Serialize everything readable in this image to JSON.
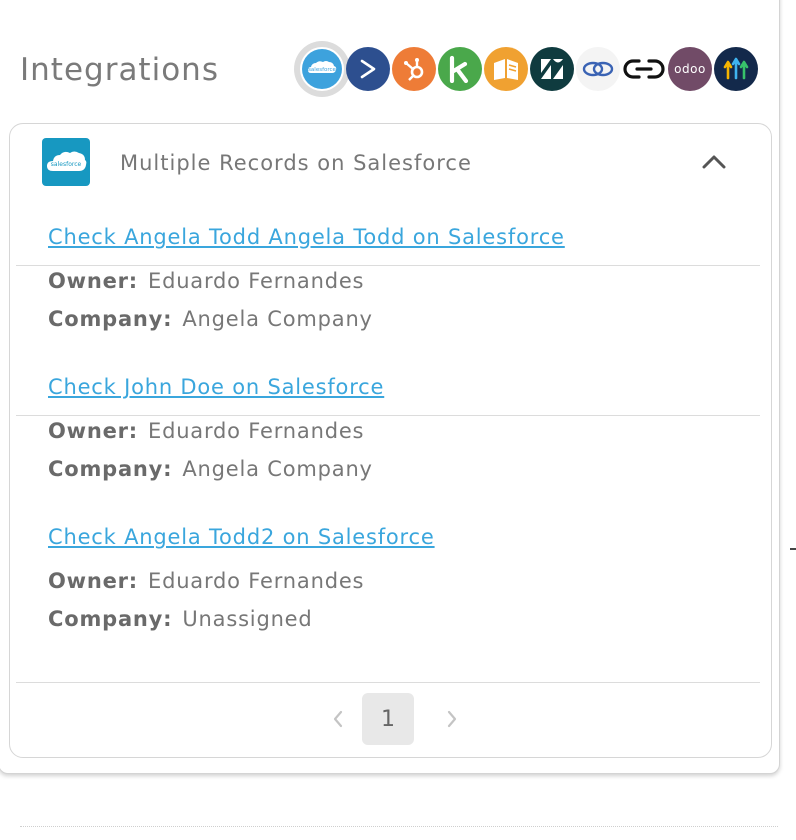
{
  "header": {
    "title": "Integrations",
    "icons": [
      {
        "name": "salesforce",
        "text": "salesforce",
        "bg": "#3da2dd",
        "selected": true
      },
      {
        "name": "pipedrive",
        "bg": "#2d4f8f"
      },
      {
        "name": "hubspot",
        "bg": "#ee7c37"
      },
      {
        "name": "keap",
        "bg": "#4aa84b"
      },
      {
        "name": "bookmark",
        "bg": "#f0a131"
      },
      {
        "name": "zendesk",
        "bg": "#0f3b3f"
      },
      {
        "name": "zoho",
        "bg": "#f4f4f4"
      },
      {
        "name": "link",
        "bg": "#ffffff"
      },
      {
        "name": "odoo",
        "text": "odoo",
        "bg": "#714b67"
      },
      {
        "name": "gohighlevel",
        "bg": "#13294b"
      }
    ]
  },
  "card": {
    "title": "Multiple Records on Salesforce",
    "logo_text": "salesforce",
    "records": [
      {
        "link": "Check Angela Todd Angela Todd on Salesforce",
        "owner_label": "Owner:",
        "owner": "Eduardo Fernandes",
        "company_label": "Company:",
        "company": "Angela Company"
      },
      {
        "link": "Check John Doe on Salesforce",
        "owner_label": "Owner:",
        "owner": "Eduardo Fernandes",
        "company_label": "Company:",
        "company": "Angela Company"
      },
      {
        "link": "Check Angela Todd2 on Salesforce",
        "owner_label": "Owner:",
        "owner": "Eduardo Fernandes",
        "company_label": "Company:",
        "company": "Unassigned"
      }
    ]
  },
  "pagination": {
    "current_page": "1"
  }
}
